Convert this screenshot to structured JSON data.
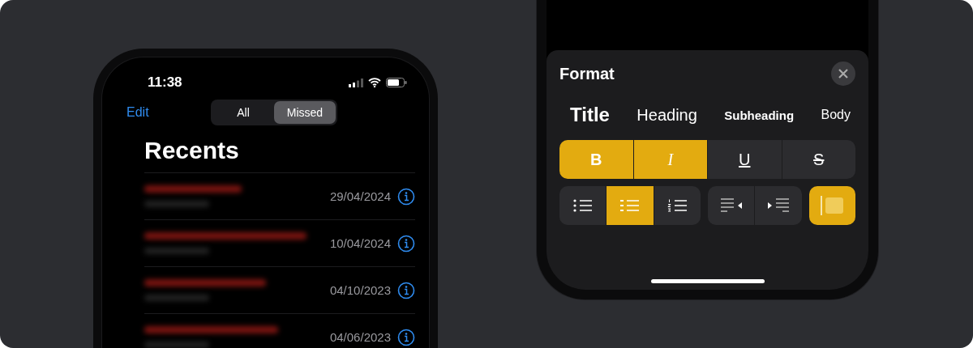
{
  "phone_recents": {
    "status_bar": {
      "time": "11:38"
    },
    "edit": "Edit",
    "segments": [
      {
        "label": "All",
        "selected": false
      },
      {
        "label": "Missed",
        "selected": true
      }
    ],
    "title": "Recents",
    "rows": [
      {
        "date": "29/04/2024"
      },
      {
        "date": "10/04/2024"
      },
      {
        "date": "04/10/2023"
      },
      {
        "date": "04/06/2023"
      }
    ]
  },
  "format_sheet": {
    "title": "Format",
    "styles": [
      {
        "label": "Title",
        "kind": "title"
      },
      {
        "label": "Heading",
        "kind": "heading"
      },
      {
        "label": "Subheading",
        "kind": "subheading"
      },
      {
        "label": "Body",
        "kind": "body"
      }
    ],
    "text_styles": [
      {
        "label": "B",
        "kind": "bold",
        "selected": true
      },
      {
        "label": "I",
        "kind": "italic",
        "selected": true
      },
      {
        "label": "U",
        "kind": "underline",
        "selected": false
      },
      {
        "label": "S",
        "kind": "strike",
        "selected": false
      }
    ],
    "lists": [
      {
        "kind": "bullets",
        "selected": false
      },
      {
        "kind": "dashes",
        "selected": true
      },
      {
        "kind": "numbers",
        "selected": false
      }
    ],
    "indents": [
      {
        "kind": "outdent"
      },
      {
        "kind": "indent"
      }
    ],
    "block_quote": {
      "selected": true
    }
  }
}
